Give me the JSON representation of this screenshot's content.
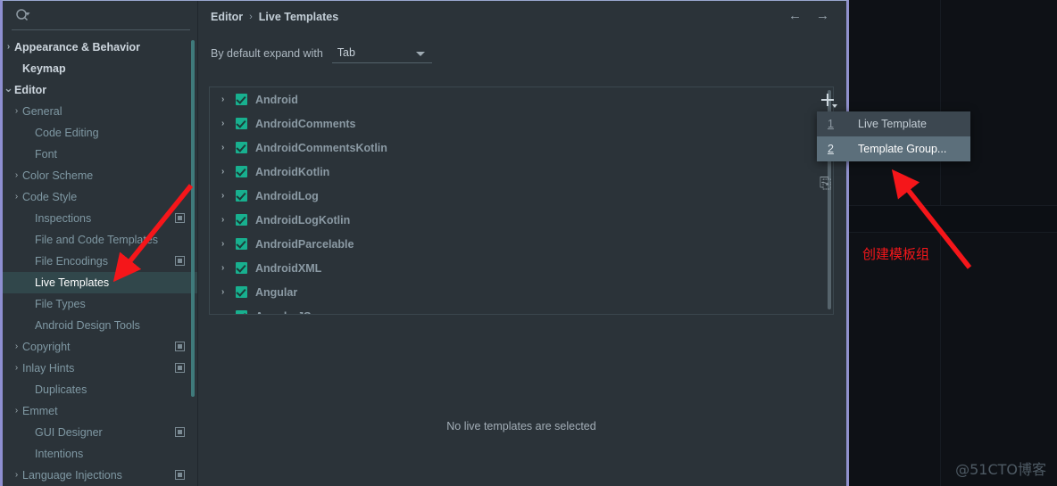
{
  "colors": {
    "dialog_bg": "#2b3339",
    "selection": "#31474b",
    "checkbox_green": "#18b08f",
    "menu_highlight": "#5c6f7b",
    "annotation_red": "#f5161a",
    "dialog_border": "#9091cd"
  },
  "sidebar": {
    "search": {
      "value": "",
      "placeholder": "",
      "icon": "search-icon"
    },
    "items": [
      {
        "label": "Appearance & Behavior",
        "arrow": "›",
        "indent": 8,
        "bold": true,
        "selected": false,
        "badge": false
      },
      {
        "label": "Keymap",
        "arrow": "",
        "indent": 22,
        "bold": true,
        "selected": false,
        "badge": false
      },
      {
        "label": "Editor",
        "arrow": "⌄",
        "indent": 8,
        "bold": true,
        "selected": false,
        "badge": false
      },
      {
        "label": "General",
        "arrow": "›",
        "indent": 22,
        "bold": false,
        "selected": false,
        "badge": false
      },
      {
        "label": "Code Editing",
        "arrow": "",
        "indent": 36,
        "bold": false,
        "selected": false,
        "badge": false
      },
      {
        "label": "Font",
        "arrow": "",
        "indent": 36,
        "bold": false,
        "selected": false,
        "badge": false
      },
      {
        "label": "Color Scheme",
        "arrow": "›",
        "indent": 22,
        "bold": false,
        "selected": false,
        "badge": false
      },
      {
        "label": "Code Style",
        "arrow": "›",
        "indent": 22,
        "bold": false,
        "selected": false,
        "badge": false
      },
      {
        "label": "Inspections",
        "arrow": "",
        "indent": 36,
        "bold": false,
        "selected": false,
        "badge": true
      },
      {
        "label": "File and Code Templates",
        "arrow": "",
        "indent": 36,
        "bold": false,
        "selected": false,
        "badge": false
      },
      {
        "label": "File Encodings",
        "arrow": "",
        "indent": 36,
        "bold": false,
        "selected": false,
        "badge": true
      },
      {
        "label": "Live Templates",
        "arrow": "",
        "indent": 36,
        "bold": false,
        "selected": true,
        "badge": false
      },
      {
        "label": "File Types",
        "arrow": "",
        "indent": 36,
        "bold": false,
        "selected": false,
        "badge": false
      },
      {
        "label": "Android Design Tools",
        "arrow": "",
        "indent": 36,
        "bold": false,
        "selected": false,
        "badge": false
      },
      {
        "label": "Copyright",
        "arrow": "›",
        "indent": 22,
        "bold": false,
        "selected": false,
        "badge": true
      },
      {
        "label": "Inlay Hints",
        "arrow": "›",
        "indent": 22,
        "bold": false,
        "selected": false,
        "badge": true
      },
      {
        "label": "Duplicates",
        "arrow": "",
        "indent": 36,
        "bold": false,
        "selected": false,
        "badge": false
      },
      {
        "label": "Emmet",
        "arrow": "›",
        "indent": 22,
        "bold": false,
        "selected": false,
        "badge": false
      },
      {
        "label": "GUI Designer",
        "arrow": "",
        "indent": 36,
        "bold": false,
        "selected": false,
        "badge": true
      },
      {
        "label": "Intentions",
        "arrow": "",
        "indent": 36,
        "bold": false,
        "selected": false,
        "badge": false
      },
      {
        "label": "Language Injections",
        "arrow": "›",
        "indent": 22,
        "bold": false,
        "selected": false,
        "badge": true
      }
    ]
  },
  "header": {
    "breadcrumb": [
      "Editor",
      "Live Templates"
    ],
    "separator": "›",
    "back_arrow": "←",
    "forward_arrow": "→"
  },
  "options": {
    "expand_label": "By default expand with",
    "expand_value": "Tab"
  },
  "templates": {
    "rows": [
      {
        "label": "Android",
        "checked": true,
        "expandable": true
      },
      {
        "label": "AndroidComments",
        "checked": true,
        "expandable": true
      },
      {
        "label": "AndroidCommentsKotlin",
        "checked": true,
        "expandable": true
      },
      {
        "label": "AndroidKotlin",
        "checked": true,
        "expandable": true
      },
      {
        "label": "AndroidLog",
        "checked": true,
        "expandable": true
      },
      {
        "label": "AndroidLogKotlin",
        "checked": true,
        "expandable": true
      },
      {
        "label": "AndroidParcelable",
        "checked": true,
        "expandable": true
      },
      {
        "label": "AndroidXML",
        "checked": true,
        "expandable": true
      },
      {
        "label": "Angular",
        "checked": true,
        "expandable": true
      },
      {
        "label": "AngularJS",
        "checked": true,
        "expandable": true
      }
    ],
    "arrow_glyph": "›",
    "empty_message": "No live templates are selected"
  },
  "toolbar": {
    "add_label": "+",
    "copy_label": "⎘"
  },
  "popup_menu": {
    "items": [
      {
        "mnemonic": "1",
        "label": "Live Template",
        "highlighted": false
      },
      {
        "mnemonic": "2",
        "label": "Template Group...",
        "highlighted": true
      }
    ]
  },
  "annotations": {
    "note_text": "创建模板组",
    "watermark": "@51CTO博客"
  }
}
